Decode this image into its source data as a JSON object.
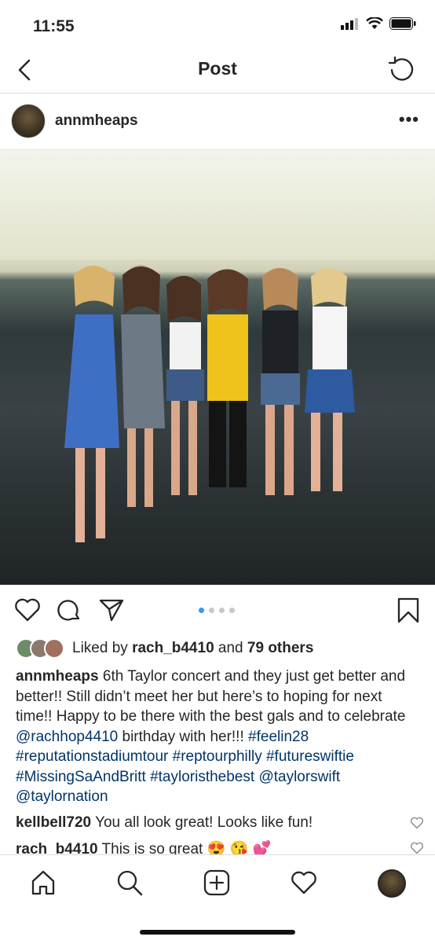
{
  "status_bar": {
    "time": "11:55"
  },
  "nav": {
    "title": "Post"
  },
  "post": {
    "username": "annmheaps",
    "more_label": "•••",
    "carousel": {
      "count": 4,
      "active": 0
    },
    "likes": {
      "prefix": "Liked by",
      "user": "rach_b4410",
      "middle": "and",
      "others": "79 others"
    },
    "caption": {
      "username": "annmheaps",
      "text1": "6th Taylor concert and they just get better and better!! Still didn’t meet her but here’s to hoping for next time!! Happy to be there with the best gals and to celebrate",
      "mention1": "@rachhop4410",
      "text2": "birthday with her!!!",
      "tags": [
        "#feelin28",
        "#reputationstadiumtour",
        "#reptourphilly",
        "#futureswiftie",
        "#MissingSaAndBritt",
        "#tayloristhebest",
        "@taylorswift",
        "@taylornation"
      ]
    },
    "comments": [
      {
        "user": "kellbell720",
        "text": "You all look great! Looks like fun!"
      },
      {
        "user": "rach_b4410",
        "text": "This is so great 😍 😘 💕"
      }
    ]
  },
  "colors": {
    "link": "#003569",
    "dot_active": "#3897f0",
    "dot_inactive": "#c7c7c7",
    "border": "#dbdbdb"
  }
}
